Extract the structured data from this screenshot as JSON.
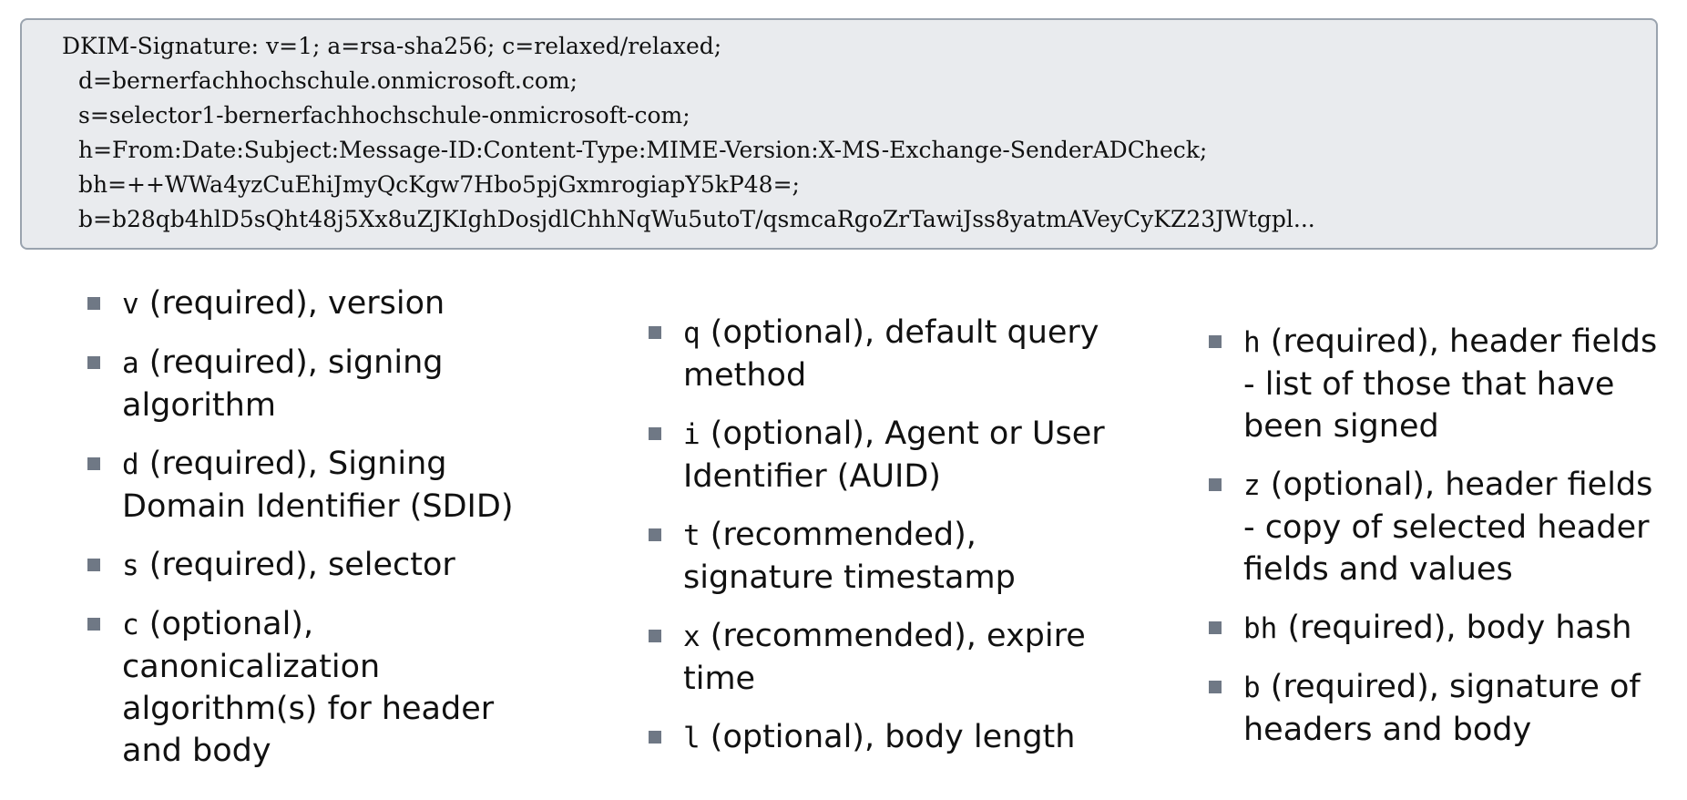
{
  "code_block": {
    "lines": [
      "DKIM-Signature: v=1; a=rsa-sha256; c=relaxed/relaxed;",
      "d=bernerfachhochschule.onmicrosoft.com;",
      "s=selector1-bernerfachhochschule-onmicrosoft-com;",
      "h=From:Date:Subject:Message-ID:Content-Type:MIME-Version:X-MS-Exchange-SenderADCheck;",
      "bh=++WWa4yzCuEhiJmyQcKgw7Hbo5pjGxmrogiapY5kP48=;",
      "b=b28qb4hlD5sQht48j5Xx8uZJKIghDosjdlChhNqWu5utoT/qsmcaRgoZrTawiJss8yatmAVeyCyKZ23JWtgpl..."
    ]
  },
  "columns": [
    {
      "items": [
        {
          "tag": "v",
          "text": " (required), version"
        },
        {
          "tag": "a",
          "text": " (required), signing algorithm"
        },
        {
          "tag": "d",
          "text": " (required), Signing Domain Identifier (SDID)"
        },
        {
          "tag": "s",
          "text": " (required), selector"
        },
        {
          "tag": "c",
          "text": " (optional), canonicalization algorithm(s) for header and body"
        }
      ]
    },
    {
      "items": [
        {
          "tag": "q",
          "text": " (optional), default query method"
        },
        {
          "tag": "i",
          "text": " (optional), Agent or User Identifier (AUID)"
        },
        {
          "tag": "t",
          "text": " (recommended), signature timestamp"
        },
        {
          "tag": "x",
          "text": " (recommended), expire time"
        },
        {
          "tag": "l",
          "text": " (optional), body length"
        }
      ]
    },
    {
      "items": [
        {
          "tag": "h",
          "text": " (required), header fields - list of those that have been signed"
        },
        {
          "tag": "z",
          "text": " (optional), header fields - copy of selected header fields and values"
        },
        {
          "tag": "bh",
          "text": " (required), body hash"
        },
        {
          "tag": "b",
          "text": " (required), signature of headers and body"
        }
      ]
    }
  ]
}
